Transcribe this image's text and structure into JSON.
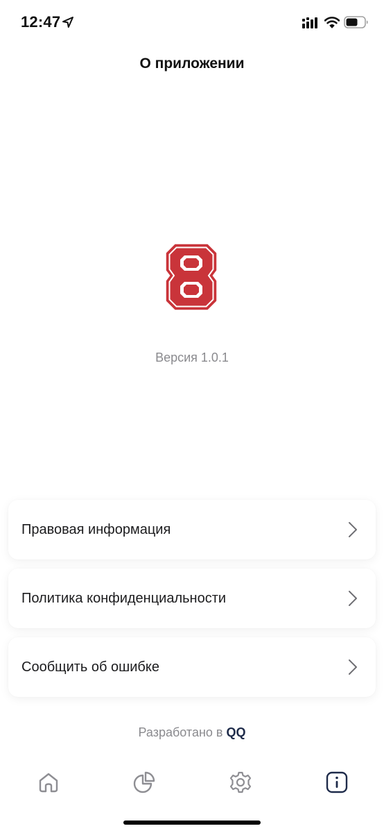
{
  "status_bar": {
    "time": "12:47",
    "icons": [
      "location-arrow-icon",
      "cellular-signal-icon",
      "wifi-icon",
      "battery-icon"
    ]
  },
  "header": {
    "title": "О приложении"
  },
  "app": {
    "logo_icon": "number-8-logo",
    "logo_color": "#c9343a",
    "version": "Версия 1.0.1"
  },
  "menu": {
    "items": [
      {
        "label": "Правовая информация",
        "icon": "chevron-right-icon"
      },
      {
        "label": "Политика конфиденциальности",
        "icon": "chevron-right-icon"
      },
      {
        "label": "Сообщить об ошибке",
        "icon": "chevron-right-icon"
      }
    ]
  },
  "footer": {
    "developed_prefix": "Разработано в ",
    "developer": "QQ",
    "developer_color": "#1e2b4a"
  },
  "tab_bar": {
    "tabs": [
      {
        "icon": "home-icon",
        "active": false
      },
      {
        "icon": "pie-chart-icon",
        "active": false
      },
      {
        "icon": "gear-icon",
        "active": false
      },
      {
        "icon": "info-icon",
        "active": true
      }
    ],
    "active_color": "#1e2b4a",
    "inactive_color": "#8e8e93"
  }
}
